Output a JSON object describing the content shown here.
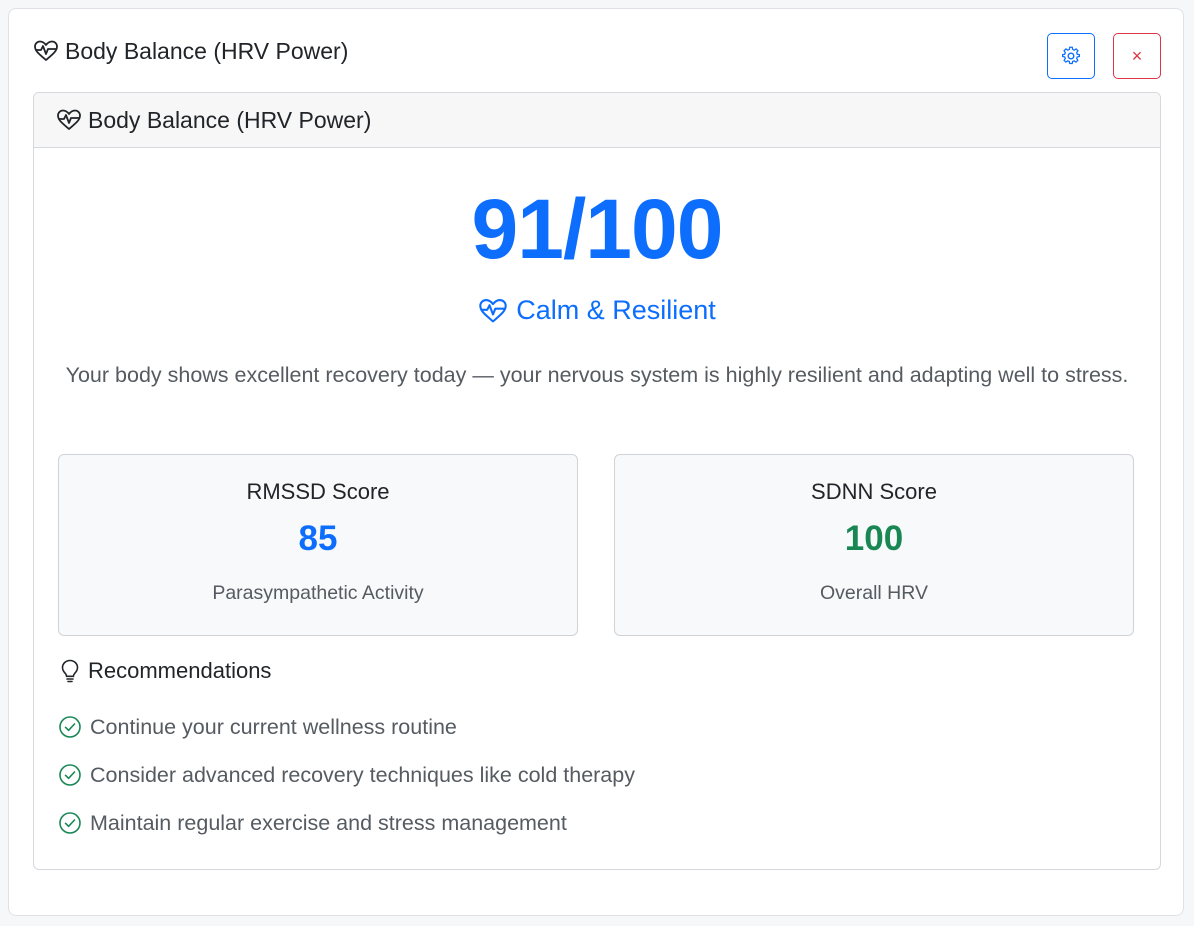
{
  "window": {
    "title": "Body Balance (HRV Power)",
    "buttons": {
      "settings_icon": "gear-icon",
      "close_label": "×"
    }
  },
  "card": {
    "header": "Body Balance (HRV Power)",
    "score": "91/100",
    "status": "Calm & Resilient",
    "description": "Your body shows excellent recovery today — your nervous system is highly resilient and adapting well to stress.",
    "metrics": [
      {
        "label": "RMSSD Score",
        "value": "85",
        "sub": "Parasympathetic Activity",
        "color": "#0d6efd"
      },
      {
        "label": "SDNN Score",
        "value": "100",
        "sub": "Overall HRV",
        "color": "#198754"
      }
    ],
    "recommendations": {
      "title": "Recommendations",
      "items": [
        "Continue your current wellness routine",
        "Consider advanced recovery techniques like cold therapy",
        "Maintain regular exercise and stress management"
      ]
    }
  },
  "colors": {
    "primary": "#0d6efd",
    "success": "#198754",
    "danger": "#dc3545"
  }
}
